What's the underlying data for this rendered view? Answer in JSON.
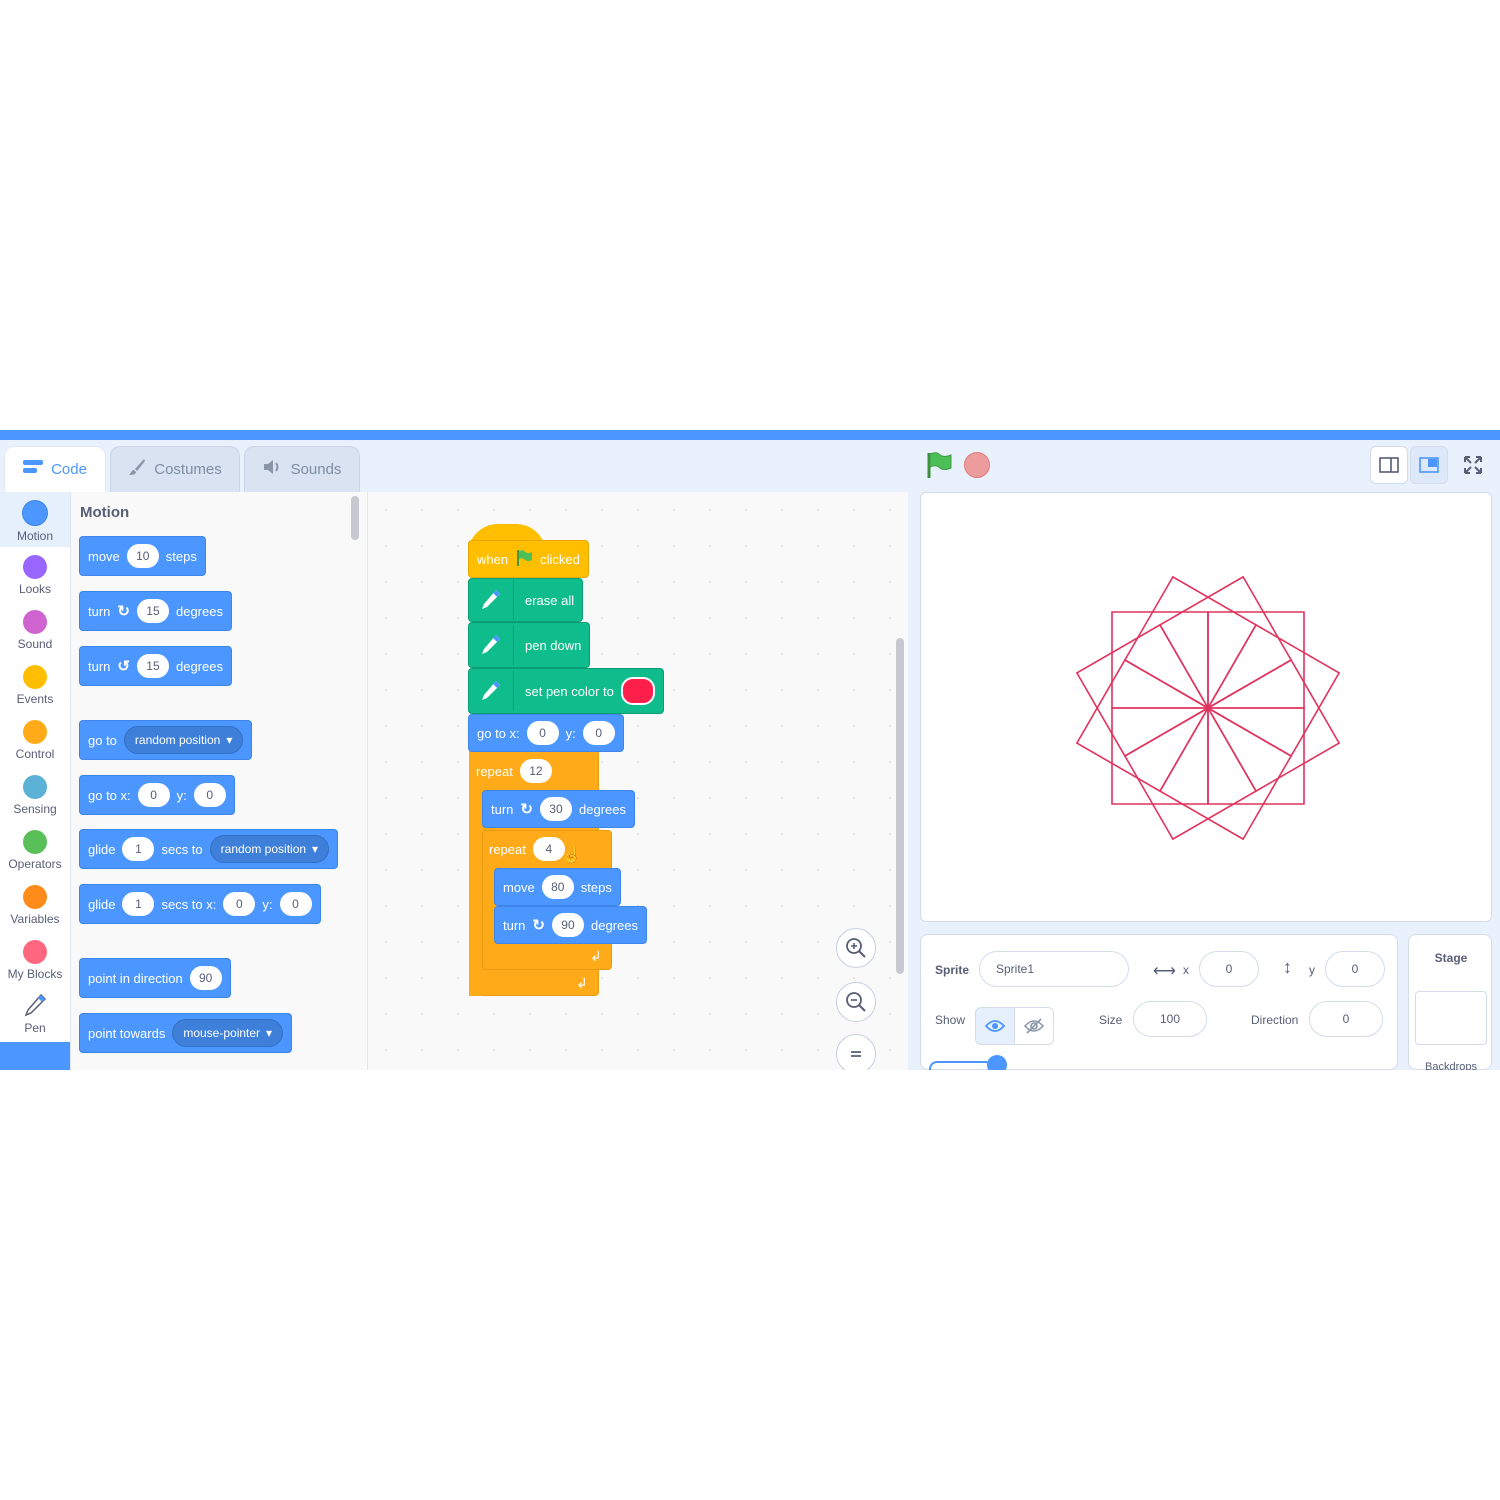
{
  "tabs": {
    "code": "Code",
    "costumes": "Costumes",
    "sounds": "Sounds"
  },
  "categories": [
    {
      "label": "Motion",
      "color": "#4c97ff"
    },
    {
      "label": "Looks",
      "color": "#9966ff"
    },
    {
      "label": "Sound",
      "color": "#cf63cf"
    },
    {
      "label": "Events",
      "color": "#ffbf00"
    },
    {
      "label": "Control",
      "color": "#ffab19"
    },
    {
      "label": "Sensing",
      "color": "#5cb1d6"
    },
    {
      "label": "Operators",
      "color": "#59c059"
    },
    {
      "label": "Variables",
      "color": "#ff8c1a"
    },
    {
      "label": "My Blocks",
      "color": "#ff6680"
    },
    {
      "label": "Pen",
      "color": "#0fbd8c"
    }
  ],
  "palette": {
    "title": "Motion",
    "move": {
      "a": "move",
      "v": "10",
      "b": "steps"
    },
    "turn_right": {
      "a": "turn",
      "v": "15",
      "b": "degrees"
    },
    "turn_left": {
      "a": "turn",
      "v": "15",
      "b": "degrees"
    },
    "goto": {
      "a": "go to",
      "dd": "random position"
    },
    "gotoxy": {
      "a": "go to x:",
      "x": "0",
      "yl": "y:",
      "y": "0"
    },
    "glide1": {
      "a": "glide",
      "v": "1",
      "b": "secs to",
      "dd": "random position"
    },
    "glide2": {
      "a": "glide",
      "v": "1",
      "b": "secs to x:",
      "x": "0",
      "yl": "y:",
      "y": "0"
    },
    "point_dir": {
      "a": "point in direction",
      "v": "90"
    },
    "point_towards": {
      "a": "point towards",
      "dd": "mouse-pointer"
    }
  },
  "script": {
    "hat": {
      "a": "when",
      "b": "clicked"
    },
    "erase": "erase all",
    "pendown": "pen down",
    "pencolor": "set pen color to",
    "gotoxy": {
      "a": "go to x:",
      "x": "0",
      "yl": "y:",
      "y": "0"
    },
    "repeat_outer": {
      "a": "repeat",
      "v": "12"
    },
    "turn_outer": {
      "a": "turn",
      "v": "30",
      "b": "degrees"
    },
    "repeat_inner": {
      "a": "repeat",
      "v": "4"
    },
    "move_inner": {
      "a": "move",
      "v": "80",
      "b": "steps"
    },
    "turn_inner": {
      "a": "turn",
      "v": "90",
      "b": "degrees"
    }
  },
  "sprite": {
    "sprite_label": "Sprite",
    "name": "Sprite1",
    "x_label": "x",
    "x": "0",
    "y_label": "y",
    "y": "0",
    "show_label": "Show",
    "size_label": "Size",
    "size": "100",
    "direction_label": "Direction",
    "direction": "0"
  },
  "stage_panel": {
    "title": "Stage",
    "backdrops": "Backdrops"
  },
  "colors": {
    "motion": "#4c97ff",
    "pen": "#0fbd8c",
    "events": "#ffbf00",
    "control": "#ffab19",
    "pen_color": "#ff1f4b",
    "drawing": "#e0335d"
  },
  "drawing": {
    "squares": 12,
    "rotation_step_deg": 30,
    "side_steps": 80
  }
}
